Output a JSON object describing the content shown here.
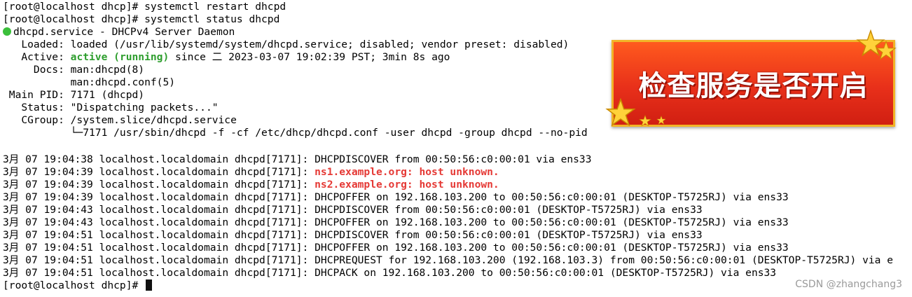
{
  "terminal": {
    "cmd1": "[root@localhost dhcp]# systemctl restart dhcpd",
    "cmd2": "[root@localhost dhcp]# systemctl status dhcpd",
    "service_title": "dhcpd.service - DHCPv4 Server Daemon",
    "loaded": "   Loaded: loaded (/usr/lib/systemd/system/dhcpd.service; disabled; vendor preset: disabled)",
    "active_label": "   Active: ",
    "active_status": "active (running)",
    "active_since": " since 二 2023-03-07 19:02:39 PST; 3min 8s ago",
    "docs1": "     Docs: man:dhcpd(8)",
    "docs2": "           man:dhcpd.conf(5)",
    "main_pid": " Main PID: 7171 (dhcpd)",
    "status": "   Status: \"Dispatching packets...\"",
    "cgroup": "   CGroup: /system.slice/dhcpd.service",
    "cgroup_child": "           └─7171 /usr/sbin/dhcpd -f -cf /etc/dhcp/dhcpd.conf -user dhcpd -group dhcpd --no-pid",
    "logs": [
      {
        "prefix": "3月 07 19:04:38 localhost.localdomain dhcpd[7171]: ",
        "msg": "DHCPDISCOVER from 00:50:56:c0:00:01 via ens33",
        "highlight": false
      },
      {
        "prefix": "3月 07 19:04:39 localhost.localdomain dhcpd[7171]: ",
        "msg": "ns1.example.org: host unknown.",
        "highlight": true
      },
      {
        "prefix": "3月 07 19:04:39 localhost.localdomain dhcpd[7171]: ",
        "msg": "ns2.example.org: host unknown.",
        "highlight": true
      },
      {
        "prefix": "3月 07 19:04:39 localhost.localdomain dhcpd[7171]: ",
        "msg": "DHCPOFFER on 192.168.103.200 to 00:50:56:c0:00:01 (DESKTOP-T5725RJ) via ens33",
        "highlight": false
      },
      {
        "prefix": "3月 07 19:04:43 localhost.localdomain dhcpd[7171]: ",
        "msg": "DHCPDISCOVER from 00:50:56:c0:00:01 (DESKTOP-T5725RJ) via ens33",
        "highlight": false
      },
      {
        "prefix": "3月 07 19:04:43 localhost.localdomain dhcpd[7171]: ",
        "msg": "DHCPOFFER on 192.168.103.200 to 00:50:56:c0:00:01 (DESKTOP-T5725RJ) via ens33",
        "highlight": false
      },
      {
        "prefix": "3月 07 19:04:51 localhost.localdomain dhcpd[7171]: ",
        "msg": "DHCPDISCOVER from 00:50:56:c0:00:01 (DESKTOP-T5725RJ) via ens33",
        "highlight": false
      },
      {
        "prefix": "3月 07 19:04:51 localhost.localdomain dhcpd[7171]: ",
        "msg": "DHCPOFFER on 192.168.103.200 to 00:50:56:c0:00:01 (DESKTOP-T5725RJ) via ens33",
        "highlight": false
      },
      {
        "prefix": "3月 07 19:04:51 localhost.localdomain dhcpd[7171]: ",
        "msg": "DHCPREQUEST for 192.168.103.200 (192.168.103.3) from 00:50:56:c0:00:01 (DESKTOP-T5725RJ) via e",
        "highlight": false
      },
      {
        "prefix": "3月 07 19:04:51 localhost.localdomain dhcpd[7171]: ",
        "msg": "DHCPACK on 192.168.103.200 to 00:50:56:c0:00:01 (DESKTOP-T5725RJ) via ens33",
        "highlight": false
      }
    ],
    "prompt": "[root@localhost dhcp]# "
  },
  "banner": {
    "text": "检查服务是否开启"
  },
  "watermark": "CSDN @zhangchang3",
  "colors": {
    "active": "#2e9e2e",
    "highlight": "#e53935",
    "banner_bg": "#e8301a",
    "banner_border": "#f2b428"
  },
  "icons": {
    "status_dot": "green-status-dot-icon",
    "stars": "gold-star-icon"
  }
}
